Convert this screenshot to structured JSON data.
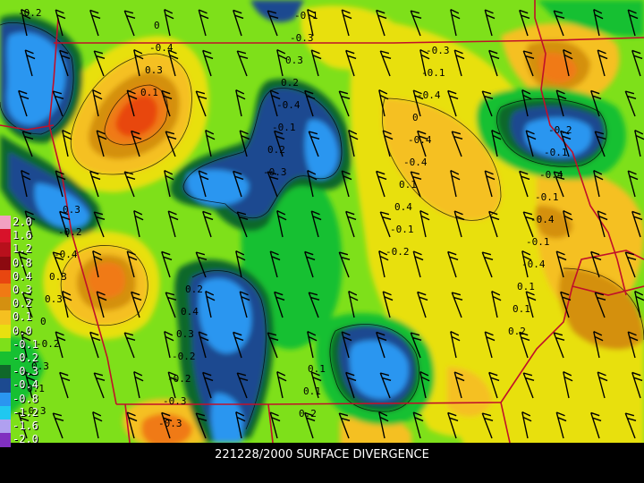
{
  "caption": "221228/2000 SURFACE DIVERGENCE",
  "legend": [
    {
      "label": "2.0",
      "color": "#f2a0c2"
    },
    {
      "label": "1.6",
      "color": "#d8122a"
    },
    {
      "label": "1.2",
      "color": "#b8101c"
    },
    {
      "label": "0.8",
      "color": "#8c0a10"
    },
    {
      "label": "0.4",
      "color": "#e84610"
    },
    {
      "label": "0.3",
      "color": "#f07a14"
    },
    {
      "label": "0.2",
      "color": "#d49010"
    },
    {
      "label": "0.1",
      "color": "#f5c020"
    },
    {
      "label": "0.0",
      "color": "#e8e010"
    },
    {
      "label": "-0.1",
      "color": "#7ee01a"
    },
    {
      "label": "-0.2",
      "color": "#18c030"
    },
    {
      "label": "-0.3",
      "color": "#10682a"
    },
    {
      "label": "-0.4",
      "color": "#1c4a90"
    },
    {
      "label": "-0.8",
      "color": "#2a96f0"
    },
    {
      "label": "-1.2",
      "color": "#20c8f0"
    },
    {
      "label": "-1.6",
      "color": "#b0a0f0"
    },
    {
      "label": "-2.0",
      "color": "#8030c0"
    }
  ],
  "contour_labels": [
    "-0.2",
    "0.1",
    "-0.3",
    "-0.2",
    "0.2",
    "-0.3",
    "0.3",
    "0.2",
    "-0.1",
    "0.1",
    "0.1",
    "-0.4",
    "-0.1",
    "0.4",
    "0.1",
    "0.3",
    "0",
    "-0.4",
    "0.1",
    "-0.4",
    "-0.2",
    "-0.3",
    "0.2",
    "-0.4",
    "-0.1",
    "0",
    "-0.3",
    "0.3",
    "-0.4",
    "-0.4",
    "0.3",
    "-0.2",
    "-0.3",
    "0",
    "-0.1",
    "0.3",
    "-0.2",
    "-0.1",
    "-0.4",
    "-0.4",
    "-0.4",
    "0.3",
    "0.2",
    "-0.1",
    "-0.1",
    "-0.2",
    "0.4",
    "0.1",
    "-0.3",
    "-0.2",
    "0.3",
    "0.2",
    "0.1"
  ]
}
